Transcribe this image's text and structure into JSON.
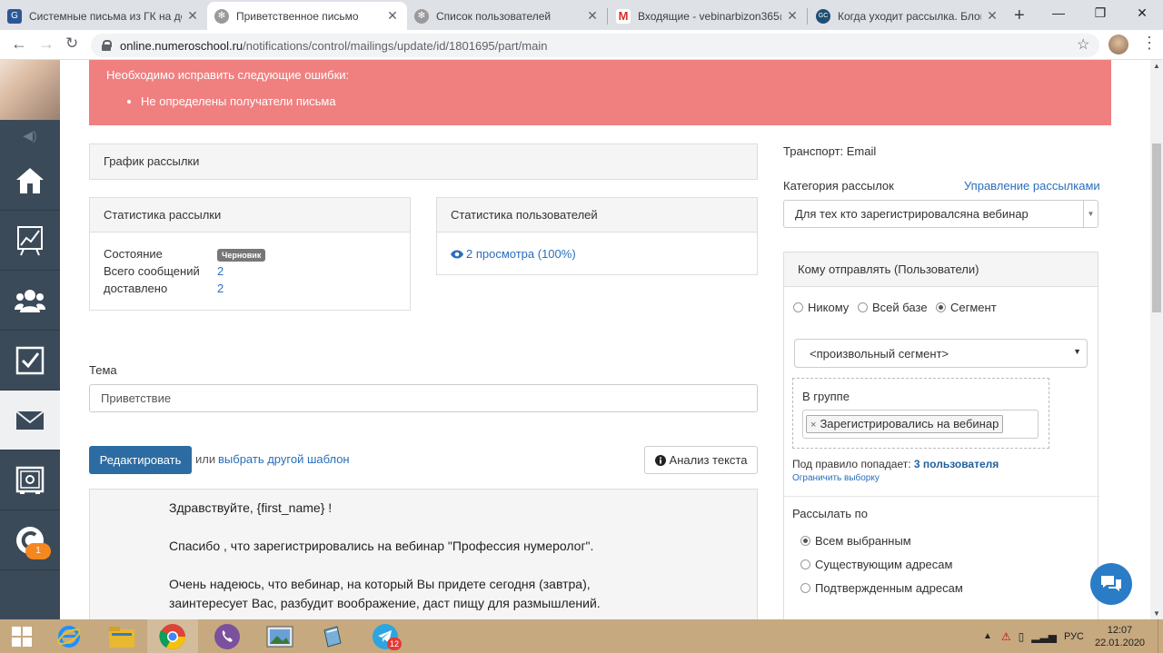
{
  "browser": {
    "tabs": [
      {
        "title": "Системные письма из ГК на до",
        "active": false
      },
      {
        "title": "Приветственное письмо",
        "active": true
      },
      {
        "title": "Список пользователей",
        "active": false
      },
      {
        "title": "Входящие - vebinarbizon365@",
        "active": false
      },
      {
        "title": "Когда уходит рассылка. Блог G",
        "active": false
      }
    ],
    "url_host": "online.numeroschool.ru",
    "url_path": "/notifications/control/mailings/update/id/1801695/part/main"
  },
  "alert": {
    "title": "Необходимо исправить следующие ошибки:",
    "errors": [
      "Не определены получатели письма"
    ]
  },
  "schedule": {
    "title": "График рассылки"
  },
  "stats_mailing": {
    "title": "Статистика рассылки",
    "state_label": "Состояние",
    "state_value": "Черновик",
    "total_label": "Всего сообщений",
    "total_value": "2",
    "delivered_label": "доставлено",
    "delivered_value": "2"
  },
  "stats_users": {
    "title": "Статистика пользователей",
    "views": "2 просмотра (100%)"
  },
  "subject": {
    "label": "Тема",
    "value": "Приветствие"
  },
  "editor": {
    "edit_button": "Редактировать",
    "or_text": "или",
    "template_link": "выбрать другой шаблон",
    "analyze_button": "Анализ текста",
    "lines": [
      "Здравствуйте, {first_name} !",
      "Спасибо , что зарегистрировались на вебинар \"Профессия нумеролог\".",
      "Очень надеюсь, что вебинар, на который Вы придете сегодня (завтра),",
      "заинтересует Вас, разбудит воображение, даст пищу для размышлений."
    ]
  },
  "right": {
    "transport": "Транспорт: Email",
    "category_label": "Категория рассылок",
    "manage_link": "Управление рассылками",
    "category_value": "Для тех кто зарегистрировалсяна вебинар",
    "recipients_title": "Кому отправлять (Пользователи)",
    "radio_none": "Никому",
    "radio_all": "Всей базе",
    "radio_segment": "Сегмент",
    "segment_value": "<произвольный сегмент>",
    "group_label": "В группе",
    "group_tag": "Зарегистрировались на вебинар",
    "rule_text": "Под правило попадает:",
    "rule_count": "3 пользователя",
    "limit_link": "Ограничить выборку",
    "send_by_title": "Рассылать по",
    "send_all": "Всем выбранным",
    "send_existing": "Существующим адресам",
    "send_confirmed": "Подтвержденным адресам"
  },
  "sidebar": {
    "notification_badge": "1"
  },
  "taskbar": {
    "lang": "РУС",
    "time": "12:07",
    "date": "22.01.2020",
    "telegram_badge": "12"
  },
  "colors": {
    "alert_bg": "#f08080",
    "sidebar_bg": "#3b4a59",
    "primary_button": "#2d6ca2",
    "link": "#2a6ebb",
    "taskbar_bg": "#c7a980"
  }
}
